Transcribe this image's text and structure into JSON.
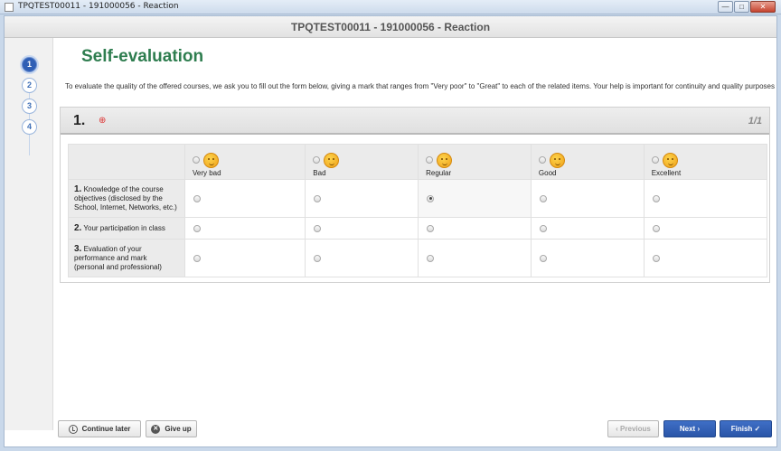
{
  "window": {
    "title": "TPQTEST00011 - 191000056 - Reaction",
    "minimize": "—",
    "maximize": "□",
    "close": "✕"
  },
  "header": {
    "title": "TPQTEST00011 - 191000056 - Reaction"
  },
  "steps": [
    "1",
    "2",
    "3",
    "4"
  ],
  "page": {
    "title": "Self-evaluation",
    "intro": "To evaluate the quality of the offered courses, we ask you to fill out the form below, giving a mark that ranges from \"Very poor\" to \"Great\" to each of the related items. Your help is important for continuity and quality purposes"
  },
  "question": {
    "number": "1.",
    "required_mark": "⊕",
    "page_indicator": "1/1",
    "options": [
      "Very bad",
      "Bad",
      "Regular",
      "Good",
      "Excellent"
    ],
    "rows": [
      {
        "num": "1.",
        "label": "Knowledge of the course objectives (disclosed by the School, Internet, Networks, etc.)",
        "selected": 2
      },
      {
        "num": "2.",
        "label": "Your participation in class",
        "selected": null
      },
      {
        "num": "3.",
        "label": "Evaluation of your performance and mark (personal and professional)",
        "selected": null
      }
    ]
  },
  "footer": {
    "continue_later": "Continue later",
    "give_up": "Give up",
    "previous": "‹  Previous",
    "next": "Next  ›",
    "finish": "Finish ✓"
  }
}
